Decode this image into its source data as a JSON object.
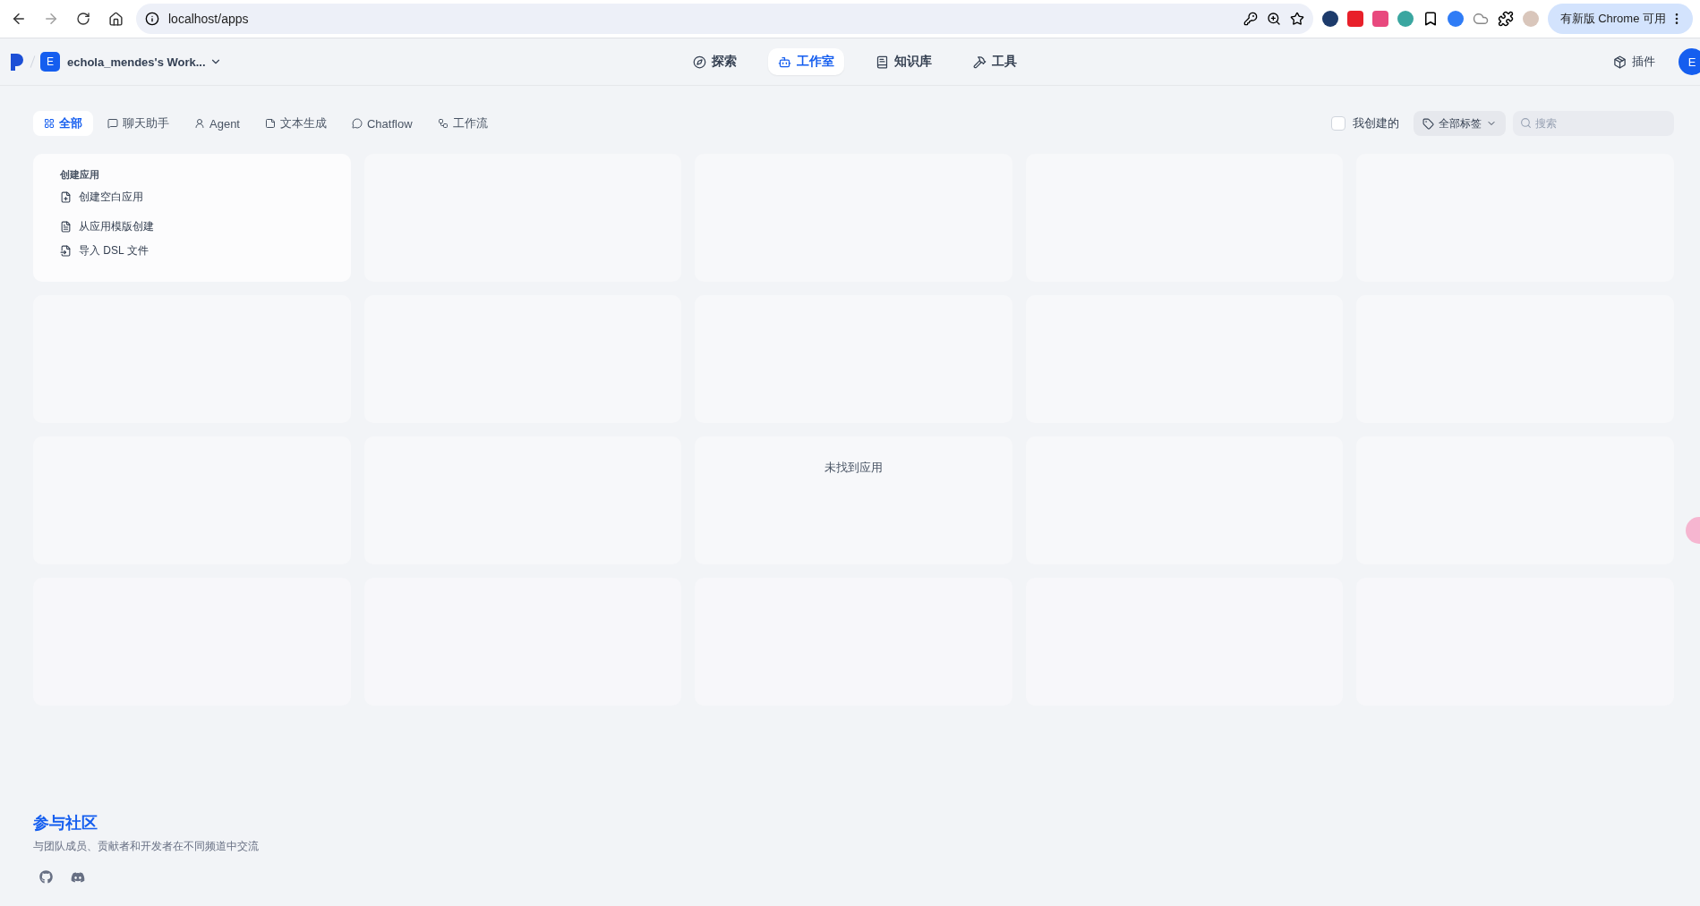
{
  "browser": {
    "url": "localhost/apps",
    "update_button": "有新版 Chrome 可用"
  },
  "header": {
    "workspace": {
      "initial": "E",
      "name": "echola_mendes's Work..."
    },
    "nav": [
      {
        "label": "探索",
        "selected": false
      },
      {
        "label": "工作室",
        "selected": true
      },
      {
        "label": "知识库",
        "selected": false
      },
      {
        "label": "工具",
        "selected": false
      }
    ],
    "plugin": "插件",
    "avatar": "E"
  },
  "filters": {
    "tabs": [
      {
        "label": "全部",
        "selected": true
      },
      {
        "label": "聊天助手",
        "selected": false
      },
      {
        "label": "Agent",
        "selected": false
      },
      {
        "label": "文本生成",
        "selected": false
      },
      {
        "label": "Chatflow",
        "selected": false
      },
      {
        "label": "工作流",
        "selected": false
      }
    ],
    "mine": {
      "label": "我创建的",
      "checked": false
    },
    "tag_select": "全部标签",
    "search": {
      "placeholder": "搜索"
    }
  },
  "create_card": {
    "title": "创建应用",
    "items": [
      "创建空白应用",
      "从应用模版创建",
      "导入 DSL 文件"
    ]
  },
  "empty_message": "未找到应用",
  "community": {
    "title": "参与社区",
    "description": "与团队成员、贡献者和开发者在不同频道中交流"
  }
}
